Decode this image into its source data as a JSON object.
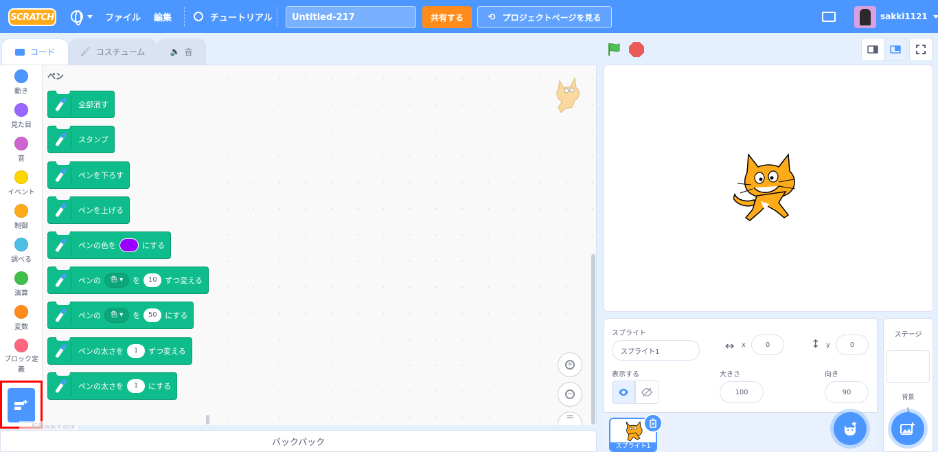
{
  "menubar": {
    "logo": "SCRATCH",
    "file": "ファイル",
    "edit": "編集",
    "tutorials": "チュートリアル",
    "project_title": "Untitled-217",
    "share": "共有する",
    "project_page": "プロジェクトページを見る",
    "username": "sakki1121"
  },
  "tabs": {
    "code": "コード",
    "costumes": "コスチューム",
    "sounds": "音"
  },
  "categories": [
    {
      "label": "動き",
      "color": "#4c97ff"
    },
    {
      "label": "見た目",
      "color": "#9966ff"
    },
    {
      "label": "音",
      "color": "#cf63cf"
    },
    {
      "label": "イベント",
      "color": "#ffd500"
    },
    {
      "label": "制御",
      "color": "#ffab19"
    },
    {
      "label": "調べる",
      "color": "#4cbfe6"
    },
    {
      "label": "演算",
      "color": "#40bf4a"
    },
    {
      "label": "変数",
      "color": "#ff8c1a"
    },
    {
      "label": "ブロック定義",
      "color": "#ff6680"
    }
  ],
  "extension": {
    "tooltip": "拡張機能を追加"
  },
  "palette": {
    "title": "ペン",
    "blocks": {
      "clear": "全部消す",
      "stamp": "スタンプ",
      "pen_down": "ペンを下ろす",
      "pen_up": "ペンを上げる",
      "set_color_pre": "ペンの色を",
      "set_color_post": "にする",
      "change_param_pre": "ペンの",
      "change_param_drop": "色",
      "change_param_mid": "を",
      "change_param_value": "10",
      "change_param_post": "ずつ変える",
      "set_param_pre": "ペンの",
      "set_param_drop": "色",
      "set_param_mid": "を",
      "set_param_value": "50",
      "set_param_post": "にする",
      "change_size_pre": "ペンの太さを",
      "change_size_value": "1",
      "change_size_post": "ずつ変える",
      "set_size_pre": "ペンの太さを",
      "set_size_value": "1",
      "set_size_post": "にする"
    },
    "pen_color": "#9900ff",
    "block_color": "#0fbd8c"
  },
  "backpack": "バックパック",
  "sprite_info": {
    "sprite_label": "スプライト",
    "sprite_name": "スプライト1",
    "x_label": "x",
    "x_value": "0",
    "y_label": "y",
    "y_value": "0",
    "show_label": "表示する",
    "size_label": "大きさ",
    "size_value": "100",
    "direction_label": "向き",
    "direction_value": "90",
    "sprite_card_label": "スプライト1"
  },
  "stage_pane": {
    "title": "ステージ",
    "backdrops_label": "背景",
    "backdrop_count": "1"
  }
}
